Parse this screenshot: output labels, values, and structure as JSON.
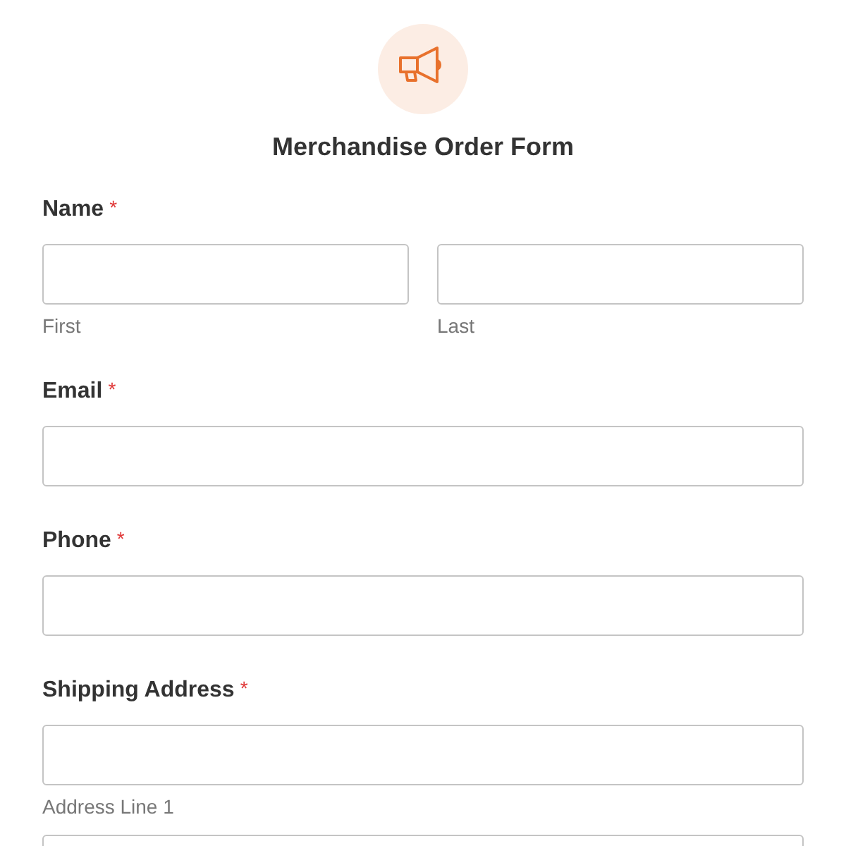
{
  "form": {
    "title": "Merchandise Order Form"
  },
  "fields": [
    {
      "label": "Name",
      "required_mark": "*",
      "kind": "split",
      "inputs": [
        {
          "kind": "text",
          "sublabel": "First"
        },
        {
          "kind": "text",
          "sublabel": "Last"
        }
      ]
    },
    {
      "label": "Email",
      "required_mark": "*",
      "kind": "stack",
      "inputs": [
        {
          "kind": "text"
        }
      ]
    },
    {
      "label": "Phone",
      "required_mark": "*",
      "kind": "stack",
      "inputs": [
        {
          "kind": "text"
        }
      ]
    },
    {
      "label": "Shipping Address",
      "required_mark": "*",
      "kind": "stack",
      "inputs": [
        {
          "kind": "text",
          "sublabel": "Address Line 1"
        },
        {
          "kind": "text"
        }
      ]
    }
  ]
}
